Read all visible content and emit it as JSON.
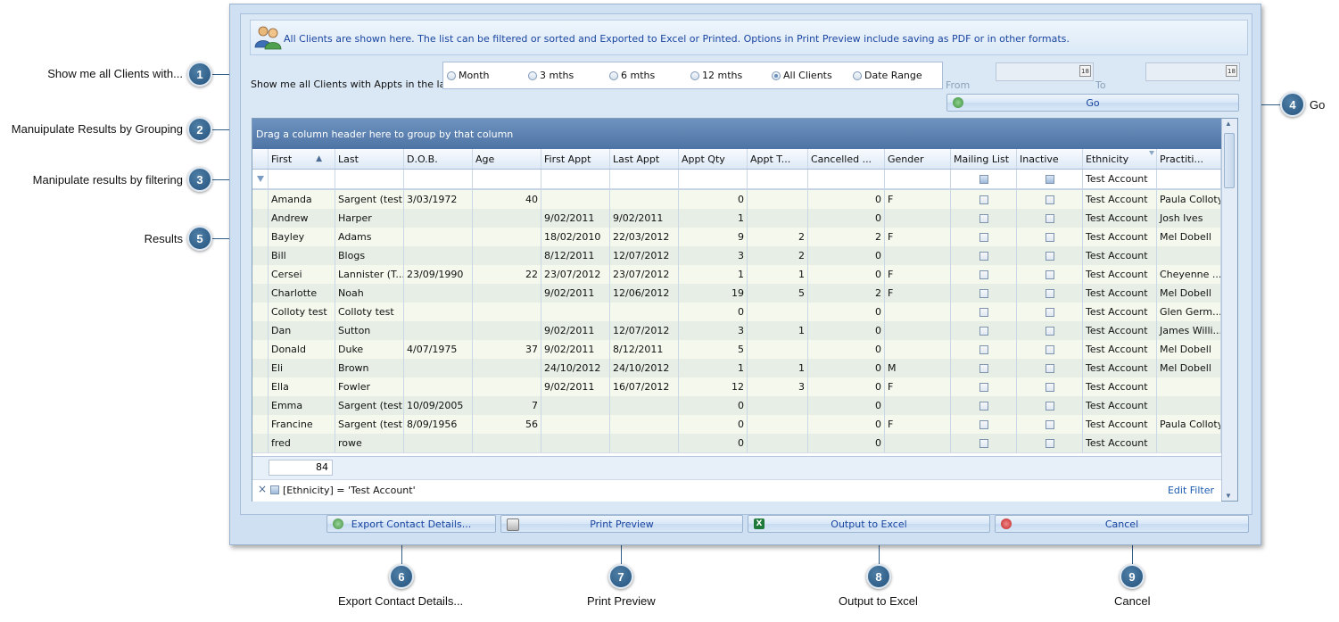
{
  "info": {
    "text": "All Clients are shown here. The list can be filtered or sorted and Exported to Excel or Printed.  Options in Print Preview include saving as PDF or in other formats."
  },
  "appts_label": "Show me all Clients with Appts in the last ...",
  "radios": [
    {
      "label": "Month",
      "selected": false
    },
    {
      "label": "3 mths",
      "selected": false
    },
    {
      "label": "6 mths",
      "selected": false
    },
    {
      "label": "12 mths",
      "selected": false
    },
    {
      "label": "All Clients",
      "selected": true
    },
    {
      "label": "Date Range",
      "selected": false
    }
  ],
  "from_label": "From",
  "to_label": "To",
  "calendar_glyph": "18",
  "go_label": "Go",
  "group_bar_text": "Drag a column header here to group by that column",
  "columns": [
    "First",
    "Last",
    "D.O.B.",
    "Age",
    "First Appt",
    "Last Appt",
    "Appt Qty",
    "Appt T...",
    "Cancelled ...",
    "Gender",
    "Mailing List",
    "Inactive",
    "Ethnicity",
    "Practiti..."
  ],
  "sort_indicator": "▲",
  "filter_value": "Test Account",
  "rows": [
    [
      "Amanda",
      "Sargent (test)",
      "3/03/1972",
      "40",
      "",
      "",
      "0",
      "",
      "0",
      "F",
      "",
      "",
      "Test Account",
      "Paula Colloty"
    ],
    [
      "Andrew",
      "Harper",
      "",
      "",
      "9/02/2011",
      "9/02/2011",
      "1",
      "",
      "0",
      "",
      "",
      "",
      "Test Account",
      "Josh Ives"
    ],
    [
      "Bayley",
      "Adams",
      "",
      "",
      "18/02/2010",
      "22/03/2012",
      "9",
      "2",
      "2",
      "F",
      "",
      "",
      "Test Account",
      "Mel Dobell"
    ],
    [
      "Bill",
      "Blogs",
      "",
      "",
      "8/12/2011",
      "12/07/2012",
      "3",
      "2",
      "0",
      "",
      "",
      "",
      "Test Account",
      ""
    ],
    [
      "Cersei",
      "Lannister (T...",
      "23/09/1990",
      "22",
      "23/07/2012",
      "23/07/2012",
      "1",
      "1",
      "0",
      "F",
      "",
      "",
      "Test Account",
      "Cheyenne ..."
    ],
    [
      "Charlotte",
      "Noah",
      "",
      "",
      "9/02/2011",
      "12/06/2012",
      "19",
      "5",
      "2",
      "F",
      "",
      "",
      "Test Account",
      "Mel Dobell"
    ],
    [
      "Colloty test",
      "Colloty test",
      "",
      "",
      "",
      "",
      "0",
      "",
      "0",
      "",
      "",
      "",
      "Test Account",
      "Glen Germ..."
    ],
    [
      "Dan",
      "Sutton",
      "",
      "",
      "9/02/2011",
      "12/07/2012",
      "3",
      "1",
      "0",
      "",
      "",
      "",
      "Test Account",
      "James Willi..."
    ],
    [
      "Donald",
      "Duke",
      "4/07/1975",
      "37",
      "9/02/2011",
      "8/12/2011",
      "5",
      "",
      "0",
      "",
      "",
      "",
      "Test Account",
      "Mel Dobell"
    ],
    [
      "Eli",
      "Brown",
      "",
      "",
      "24/10/2012",
      "24/10/2012",
      "1",
      "1",
      "0",
      "M",
      "",
      "",
      "Test Account",
      "Mel Dobell"
    ],
    [
      "Ella",
      "Fowler",
      "",
      "",
      "9/02/2011",
      "16/07/2012",
      "12",
      "3",
      "0",
      "F",
      "",
      "",
      "Test Account",
      ""
    ],
    [
      "Emma",
      "Sargent (test)",
      "10/09/2005",
      "7",
      "",
      "",
      "0",
      "",
      "0",
      "",
      "",
      "",
      "Test Account",
      ""
    ],
    [
      "Francine",
      "Sargent (test)",
      "8/09/1956",
      "56",
      "",
      "",
      "0",
      "",
      "0",
      "F",
      "",
      "",
      "Test Account",
      "Paula Colloty"
    ],
    [
      "fred",
      "rowe",
      "",
      "",
      "",
      "",
      "0",
      "",
      "0",
      "",
      "",
      "",
      "Test Account",
      ""
    ]
  ],
  "count_value": "84",
  "active_filter": "[Ethnicity] = 'Test Account'",
  "edit_filter": "Edit Filter",
  "clear_filter": "×",
  "buttons": {
    "export": "Export Contact Details...",
    "print": "Print Preview",
    "excel": "Output to Excel",
    "cancel": "Cancel"
  },
  "excel_icon_glyph": "X",
  "callouts": [
    {
      "num": "1",
      "label": "Show me all Clients with..."
    },
    {
      "num": "2",
      "label": "Manuipulate Results by Grouping"
    },
    {
      "num": "3",
      "label": "Manipulate results by filtering"
    },
    {
      "num": "4",
      "label": "Go"
    },
    {
      "num": "5",
      "label": "Results"
    },
    {
      "num": "6",
      "label": "Export Contact Details..."
    },
    {
      "num": "7",
      "label": "Print Preview"
    },
    {
      "num": "8",
      "label": "Output to Excel"
    },
    {
      "num": "9",
      "label": "Cancel"
    }
  ],
  "colors": {
    "accent": "#1a45a0",
    "group_bar": "#5a7fb0",
    "callout": "#2f5f8a",
    "row_alt": "#e6eee6",
    "row": "#f4f8ed"
  }
}
